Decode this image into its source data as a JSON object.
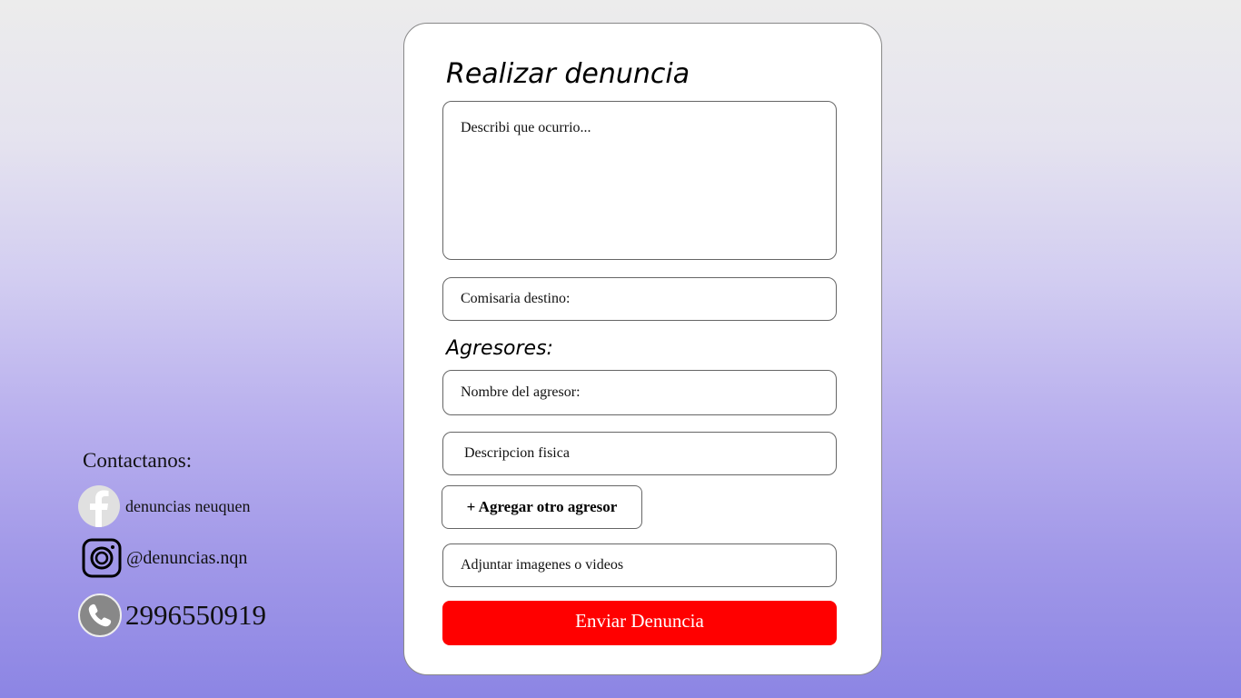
{
  "form": {
    "title": "Realizar denuncia",
    "description_placeholder": "Describi que ocurrio...",
    "comisaria_placeholder": "Comisaria destino:",
    "agresores_label": "Agresores:",
    "agresor_nombre_placeholder": "Nombre del agresor:",
    "agresor_descripcion_placeholder": "Descripcion fisica",
    "add_agresor_label": "+ Agregar otro agresor",
    "attach_label": "Adjuntar imagenes o videos",
    "submit_label": "Enviar Denuncia",
    "submit_color": "#ff0000"
  },
  "contact": {
    "title": "Contactanos:",
    "facebook": {
      "icon": "facebook-icon",
      "text": "denuncias neuquen"
    },
    "instagram": {
      "icon": "instagram-icon",
      "text": "@denuncias.nqn"
    },
    "phone": {
      "icon": "phone-icon",
      "text": "2996550919"
    }
  }
}
